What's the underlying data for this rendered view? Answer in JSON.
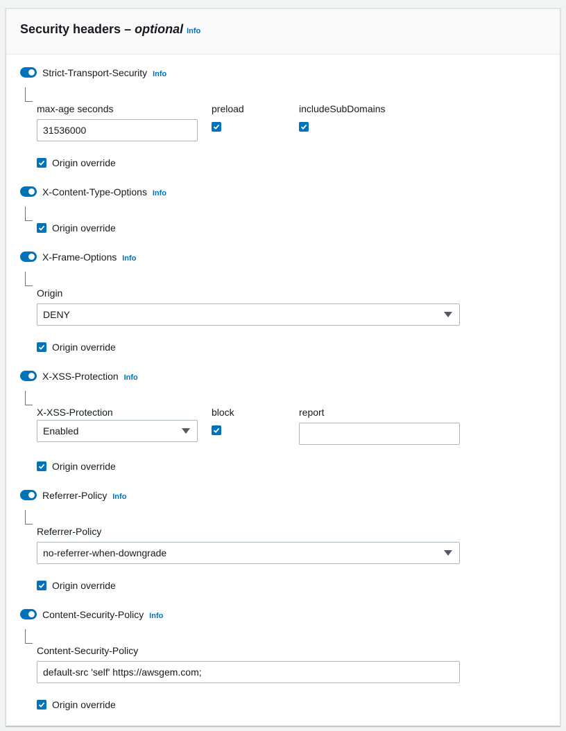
{
  "panel": {
    "title": "Security headers – ",
    "title_optional": "optional",
    "info": "Info"
  },
  "sections": {
    "hsts": {
      "label": "Strict-Transport-Security",
      "info": "Info",
      "enabled": true,
      "max_age_label": "max-age seconds",
      "max_age_value": "31536000",
      "preload_label": "preload",
      "preload_checked": true,
      "include_subdomains_label": "includeSubDomains",
      "include_subdomains_checked": true,
      "origin_override_label": "Origin override",
      "origin_override_checked": true
    },
    "xcto": {
      "label": "X-Content-Type-Options",
      "info": "Info",
      "enabled": true,
      "origin_override_label": "Origin override",
      "origin_override_checked": true
    },
    "xfo": {
      "label": "X-Frame-Options",
      "info": "Info",
      "enabled": true,
      "origin_label": "Origin",
      "origin_value": "DENY",
      "origin_override_label": "Origin override",
      "origin_override_checked": true
    },
    "xxss": {
      "label": "X-XSS-Protection",
      "info": "Info",
      "enabled": true,
      "protection_label": "X-XSS-Protection",
      "protection_value": "Enabled",
      "block_label": "block",
      "block_checked": true,
      "report_label": "report",
      "report_value": "",
      "origin_override_label": "Origin override",
      "origin_override_checked": true
    },
    "referrer": {
      "label": "Referrer-Policy",
      "info": "Info",
      "enabled": true,
      "policy_label": "Referrer-Policy",
      "policy_value": "no-referrer-when-downgrade",
      "origin_override_label": "Origin override",
      "origin_override_checked": true
    },
    "csp": {
      "label": "Content-Security-Policy",
      "info": "Info",
      "enabled": true,
      "policy_label": "Content-Security-Policy",
      "policy_value": "default-src 'self' https://awsgem.com;",
      "origin_override_label": "Origin override",
      "origin_override_checked": true
    }
  },
  "colors": {
    "accent": "#0073bb",
    "text": "#16191f",
    "border": "#aab7b8"
  }
}
